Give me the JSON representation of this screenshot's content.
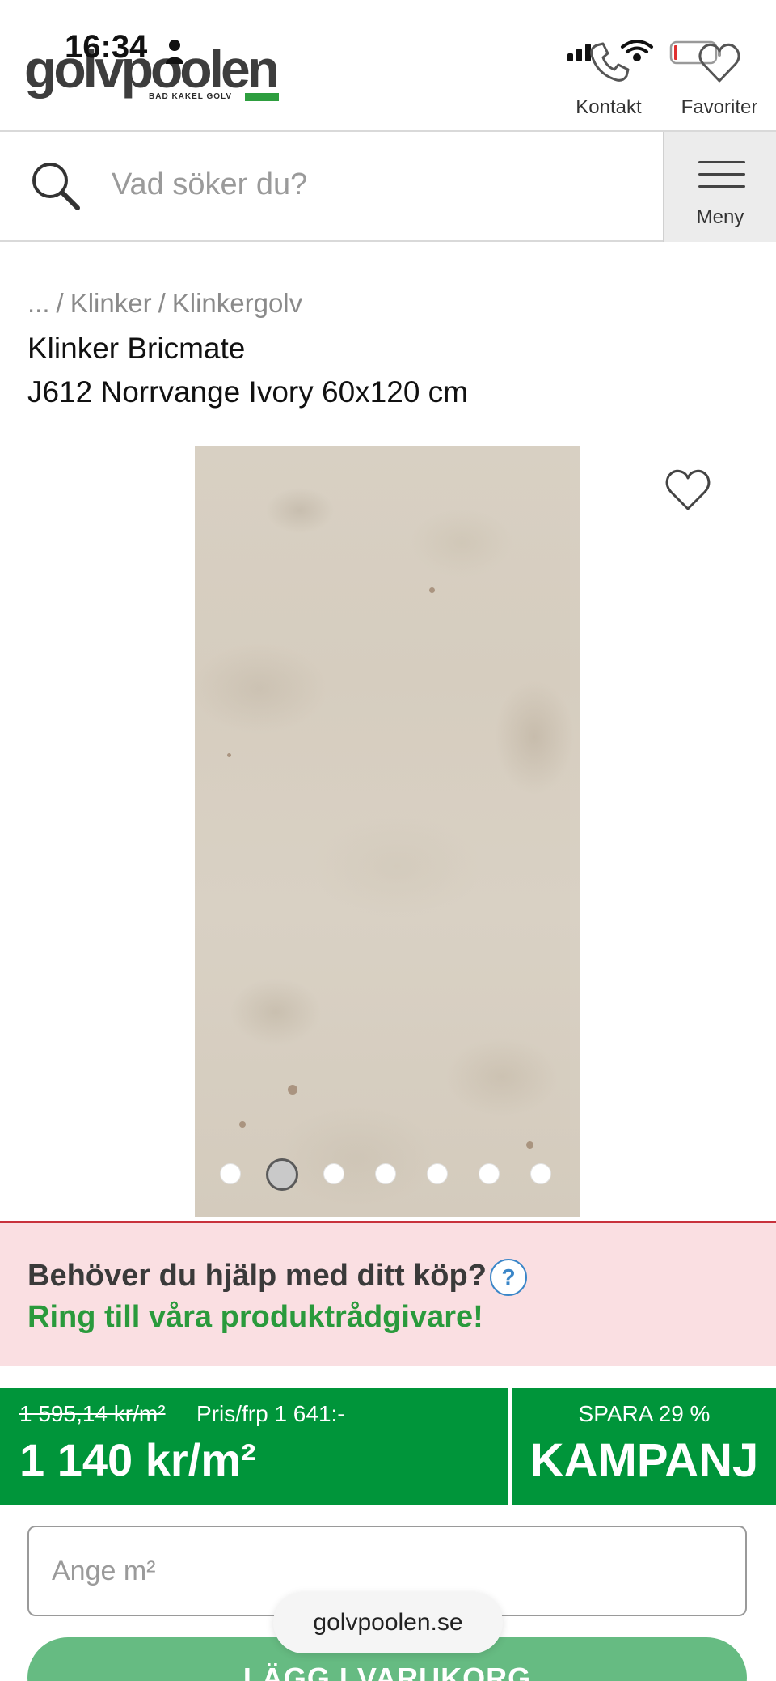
{
  "status_bar": {
    "time": "16:34",
    "person_icon": "person-icon",
    "signal_icon": "signal-bars-icon",
    "wifi_icon": "wifi-icon",
    "battery_icon": "battery-low-icon"
  },
  "header": {
    "logo_text": "golvpoolen",
    "logo_tagline": "BAD KAKEL GOLV",
    "contact_label": "Kontakt",
    "favorites_label": "Favoriter",
    "brand_color": "#2e9e3f"
  },
  "search": {
    "placeholder": "Vad söker du?",
    "value": "",
    "menu_label": "Meny"
  },
  "breadcrumb": {
    "items": [
      "...",
      "Klinker",
      "Klinkergolv"
    ],
    "separator": "/"
  },
  "product": {
    "title_line1": "Klinker Bricmate",
    "title_line2": "J612 Norrvange Ivory 60x120 cm",
    "image_count": 7,
    "active_image_index": 1
  },
  "help": {
    "question": "Behöver du hjälp med ditt köp?",
    "info_symbol": "?",
    "call_text": "Ring till våra produktrådgivare!"
  },
  "price": {
    "old_price": "1 595,14 kr/m²",
    "per_package": "Pris/frp 1 641:-",
    "current_price": "1 140 kr/m²",
    "save_text": "SPARA 29 %",
    "campaign_label": "KAMPANJ",
    "price_bg": "#00953a"
  },
  "purchase": {
    "quantity_placeholder": "Ange m²",
    "quantity_value": "",
    "add_to_cart_label": "LÄGG I VARUKORG"
  },
  "browser": {
    "url": "golvpoolen.se"
  }
}
